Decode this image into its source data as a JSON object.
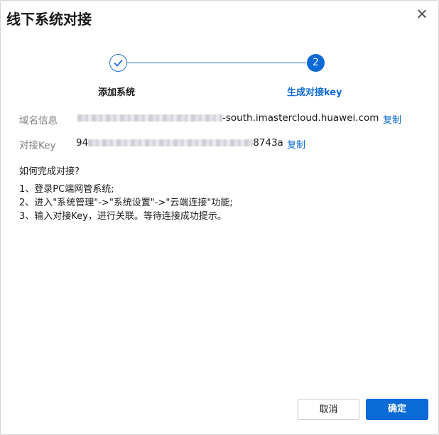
{
  "dialog": {
    "title": "线下系统对接",
    "close_icon": "close-icon"
  },
  "stepper": {
    "steps": [
      {
        "label": "添加系统",
        "status": "completed",
        "icon": "check-icon"
      },
      {
        "label": "生成对接key",
        "status": "active",
        "number": "2"
      }
    ],
    "accent_color": "#0a6ad6"
  },
  "info": {
    "domain_label": "域名信息",
    "domain_suffix": "-south.imastercloud.huawei.com",
    "key_label": "对接Key",
    "key_prefix": "94",
    "key_suffix": "8743a",
    "copy_label": "复制"
  },
  "instructions": {
    "heading": "如何完成对接?",
    "items": [
      "1、登录PC端网管系统;",
      "2、进入\"系统管理\"->\"系统设置\"->\"云端连接\"功能;",
      "3、输入对接Key，进行关联。等待连接成功提示。"
    ]
  },
  "footer": {
    "cancel_label": "取消",
    "confirm_label": "确定"
  }
}
